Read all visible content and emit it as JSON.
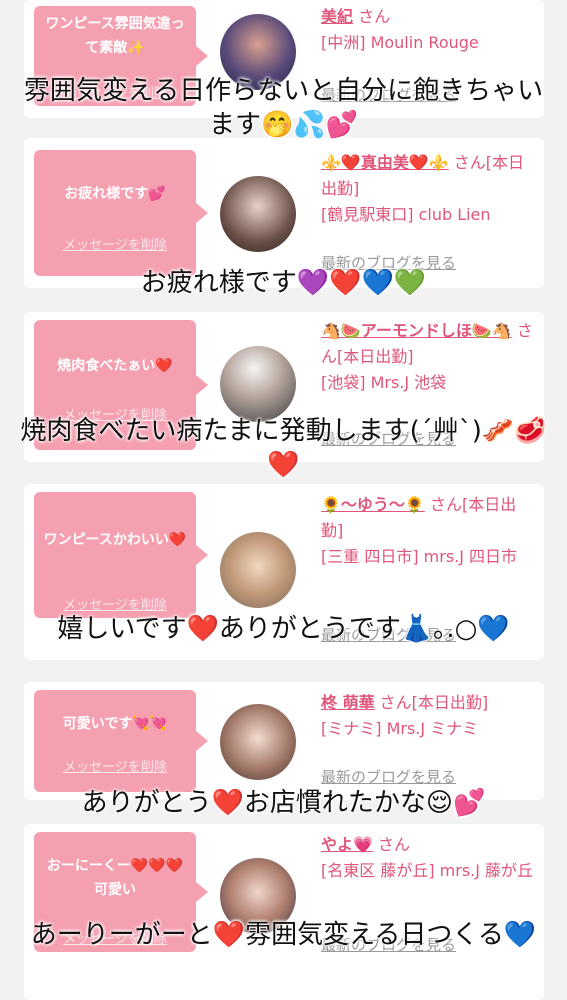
{
  "ui": {
    "delete_label": "メッセージを削除",
    "blog_label": "最新のブログを見る"
  },
  "cards": [
    {
      "message": "ワンピース雰囲気違って素敵✨",
      "name": "美紀",
      "suffix": "さん",
      "shop": "[中洲] Moulin Rouge",
      "overlay": "雰囲気変える日作らないと自分に飽きちゃいます🤭💦💕"
    },
    {
      "message": "お疲れ様です💕",
      "name": "⚜️❤️真由美❤️⚜️",
      "suffix": "さん[本日出勤]",
      "shop": "[鶴見駅東口] club Lien",
      "overlay": "お疲れ様です💜❤️💙💚"
    },
    {
      "message": "焼肉食べたぁい❤️",
      "name": "🐴🍉アーモンドしほ🍉🐴",
      "suffix": "さん[本日出勤]",
      "shop": "[池袋] Mrs.J 池袋",
      "overlay": "焼肉食べたい病たまに発動します(´艸`)🥓🥩❤️"
    },
    {
      "message": "ワンピースかわいい❤️",
      "name": "🌻〜ゆう〜🌻",
      "suffix": "さん[本日出勤]",
      "shop": "[三重 四日市] mrs.J 四日市",
      "overlay": "嬉しいです❤️ありがとうです👗｡.○💙"
    },
    {
      "message": "可愛いです💘💘",
      "name": "柊 萌華",
      "suffix": "さん[本日出勤]",
      "shop": "[ミナミ] Mrs.J ミナミ",
      "overlay": "ありがとう❤️お店慣れたかな😌💕"
    },
    {
      "message": "おーにーくー❤️❤️❤️可愛い",
      "name": "やよ💗",
      "suffix": "さん",
      "shop": "[名東区 藤が丘] mrs.J 藤が丘",
      "overlay": "あーりーがーと❤️雰囲気変える日つくる💙"
    }
  ],
  "colors": {
    "bubble": "#f5a0b1",
    "accent": "#e0567a",
    "background": "#f2f2f2"
  }
}
